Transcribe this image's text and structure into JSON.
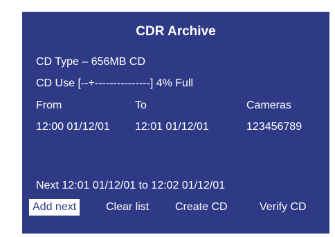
{
  "screen": {
    "title": "CDR Archive",
    "cd_type": "CD Type – 656MB CD",
    "cd_use": "CD Use [--+---------------] 4% Full",
    "headers": {
      "from": "From",
      "to": "To",
      "cameras": "Cameras"
    },
    "row": {
      "from": "12:00 01/12/01",
      "to": "12:01 01/12/01",
      "cameras": "123456789"
    },
    "next": "Next  12:01 01/12/01 to 12:02 01/12/01",
    "buttons": {
      "add_next": "Add next",
      "clear_list": "Clear list",
      "create_cd": "Create CD",
      "verify_cd": "Verify CD"
    },
    "selected_button": "add_next"
  }
}
